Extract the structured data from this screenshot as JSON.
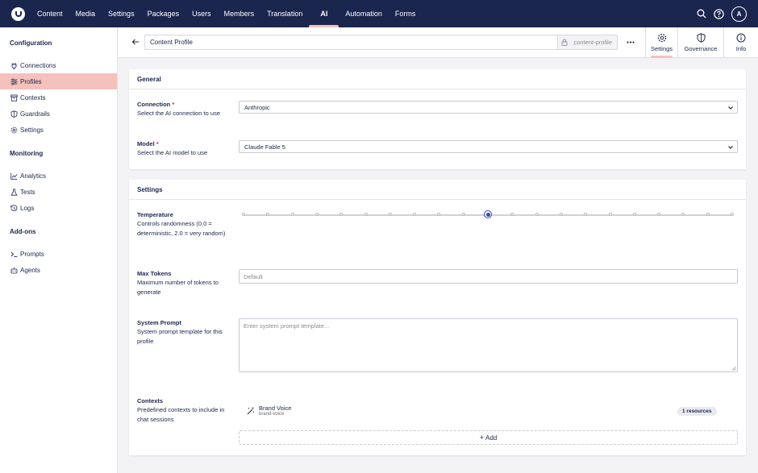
{
  "topnav": {
    "items": [
      "Content",
      "Media",
      "Settings",
      "Packages",
      "Users",
      "Members",
      "Translation",
      "AI",
      "Automation",
      "Forms"
    ],
    "active": "AI",
    "user_initial": "A"
  },
  "sidebar": {
    "sections": [
      {
        "title": "Configuration",
        "items": [
          "Connections",
          "Profiles",
          "Contexts",
          "Guardrails",
          "Settings"
        ]
      },
      {
        "title": "Monitoring",
        "items": [
          "Analytics",
          "Tests",
          "Logs"
        ]
      },
      {
        "title": "Add-ons",
        "items": [
          "Prompts",
          "Agents"
        ]
      }
    ],
    "active_item": "Profiles"
  },
  "header": {
    "name": "Content Profile",
    "alias": "content-profile",
    "tabs": [
      "Settings",
      "Governance",
      "Info"
    ],
    "active_tab": "Settings"
  },
  "general": {
    "title": "General",
    "connection": {
      "label": "Connection",
      "required": "*",
      "desc": "Select the AI connection to use",
      "value": "Anthropic"
    },
    "model": {
      "label": "Model",
      "required": "*",
      "desc": "Select the AI model to use",
      "value": "Claude Fable 5"
    }
  },
  "settings": {
    "title": "Settings",
    "temperature": {
      "label": "Temperature",
      "desc": "Controls randomness (0.0 = deterministic, 2.0 = very random)",
      "value": 1.0,
      "min": 0.0,
      "max": 2.0,
      "step": 0.1
    },
    "max_tokens": {
      "label": "Max Tokens",
      "desc": "Maximum number of tokens to generate",
      "placeholder": "Default"
    },
    "system_prompt": {
      "label": "System Prompt",
      "desc": "System prompt template for this profile",
      "placeholder": "Enter system prompt template..."
    },
    "contexts": {
      "label": "Contexts",
      "desc": "Predefined contexts to include in chat sessions",
      "items": [
        {
          "name": "Brand Voice",
          "alias": "brand-voice",
          "badge": "1 resources"
        }
      ],
      "add_label": "Add"
    }
  },
  "colors": {
    "topbar": "#1b264f",
    "accent_pink": "#f5c1bc",
    "slider_blue": "#3544b1"
  }
}
